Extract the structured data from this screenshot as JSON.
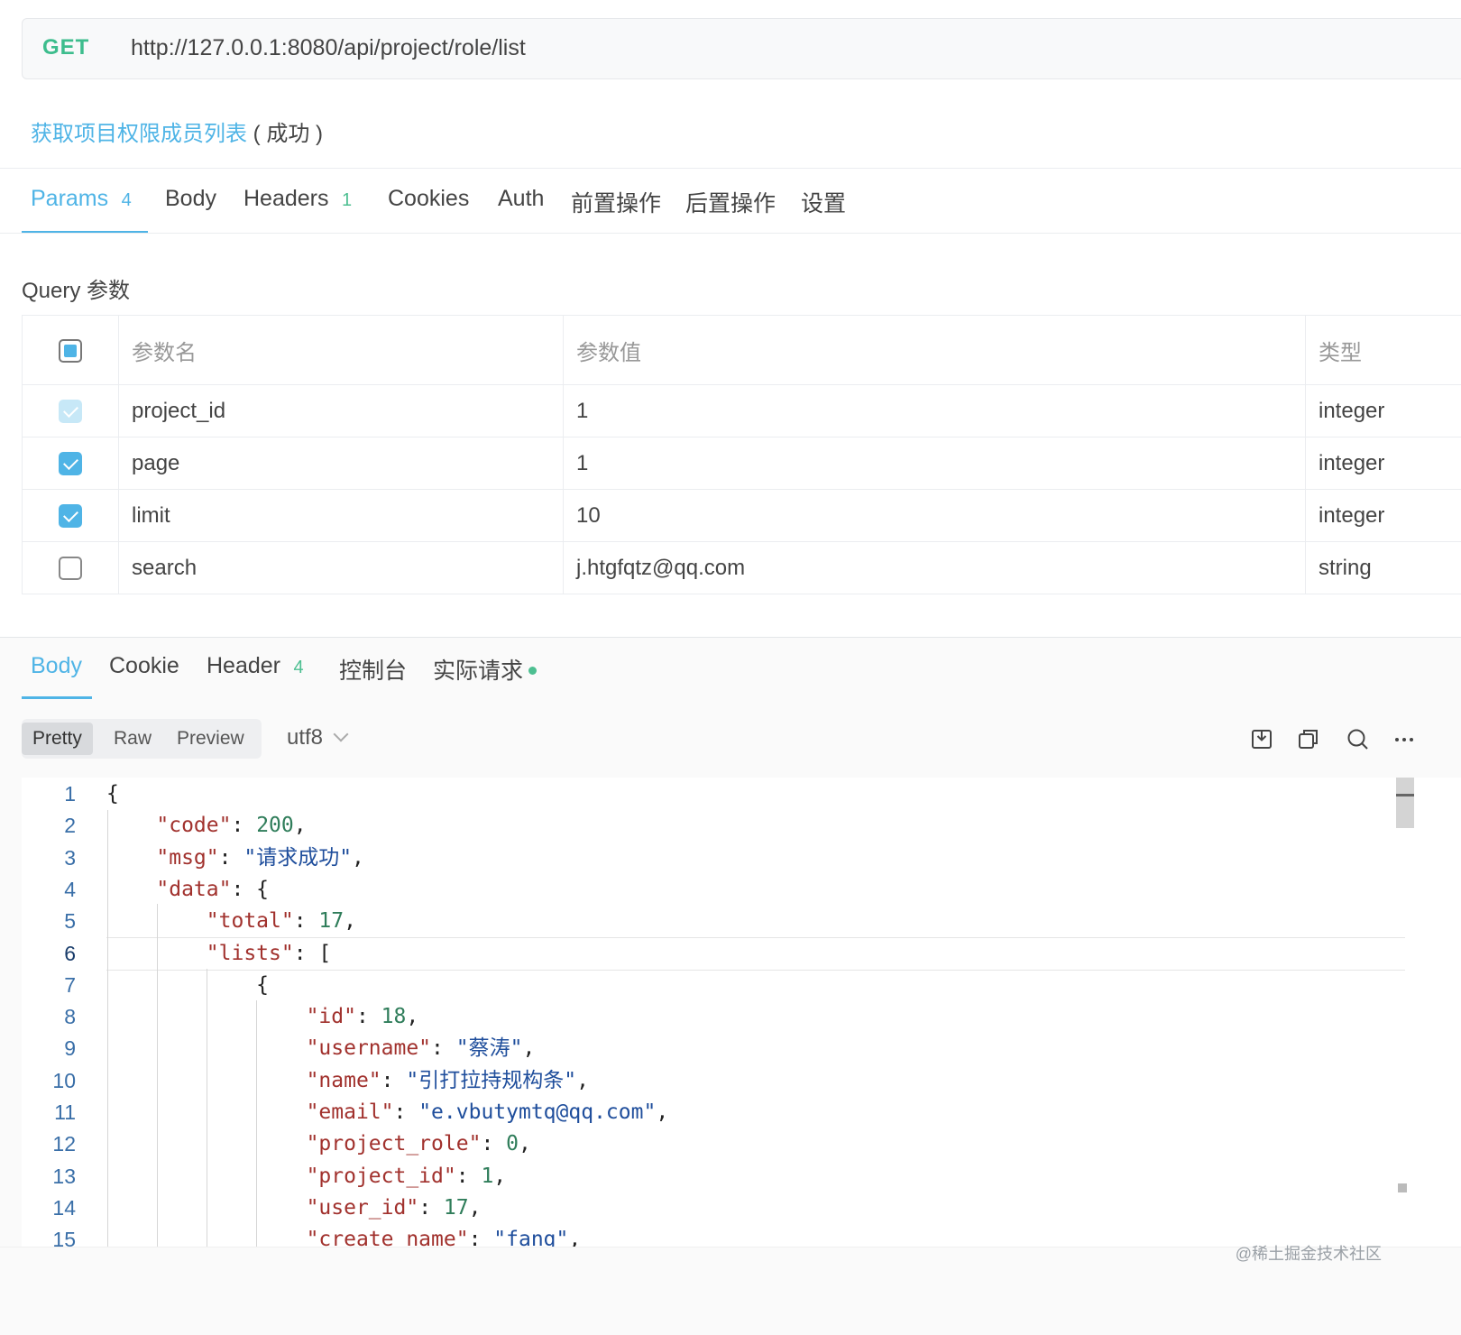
{
  "request": {
    "method": "GET",
    "url": "http://127.0.0.1:8080/api/project/role/list",
    "api_name": "获取项目权限成员列表",
    "api_status": "( 成功 )"
  },
  "request_tabs": [
    {
      "label": "Params",
      "count": "4"
    },
    {
      "label": "Body"
    },
    {
      "label": "Headers",
      "count": "1"
    },
    {
      "label": "Cookies"
    },
    {
      "label": "Auth"
    },
    {
      "label": "前置操作"
    },
    {
      "label": "后置操作"
    },
    {
      "label": "设置"
    }
  ],
  "query_section_label": "Query 参数",
  "params_table": {
    "headers": [
      "参数名",
      "参数值",
      "类型"
    ],
    "rows": [
      {
        "checked": "light",
        "name": "project_id",
        "value": "1",
        "type": "integer"
      },
      {
        "checked": "yes",
        "name": "page",
        "value": "1",
        "type": "integer"
      },
      {
        "checked": "yes",
        "name": "limit",
        "value": "10",
        "type": "integer"
      },
      {
        "checked": "no",
        "name": "search",
        "value": "j.htgfqtz@qq.com",
        "type": "string"
      }
    ]
  },
  "response_tabs": [
    {
      "label": "Body"
    },
    {
      "label": "Cookie"
    },
    {
      "label": "Header",
      "count": "4"
    },
    {
      "label": "控制台"
    },
    {
      "label": "实际请求"
    }
  ],
  "view_modes": [
    "Pretty",
    "Raw",
    "Preview"
  ],
  "encoding": "utf8",
  "toolbar_icons": [
    "save-icon",
    "copy-icon",
    "search-icon",
    "more-icon"
  ],
  "code_lines": [
    {
      "n": "1",
      "text": "{"
    },
    {
      "n": "2",
      "text": "    \"code\": 200,"
    },
    {
      "n": "3",
      "text": "    \"msg\": \"请求成功\","
    },
    {
      "n": "4",
      "text": "    \"data\": {"
    },
    {
      "n": "5",
      "text": "        \"total\": 17,"
    },
    {
      "n": "6",
      "text": "        \"lists\": ["
    },
    {
      "n": "7",
      "text": "            {"
    },
    {
      "n": "8",
      "text": "                \"id\": 18,"
    },
    {
      "n": "9",
      "text": "                \"username\": \"蔡涛\","
    },
    {
      "n": "10",
      "text": "                \"name\": \"引打拉持规构条\","
    },
    {
      "n": "11",
      "text": "                \"email\": \"e.vbutymtq@qq.com\","
    },
    {
      "n": "12",
      "text": "                \"project_role\": 0,"
    },
    {
      "n": "13",
      "text": "                \"project_id\": 1,"
    },
    {
      "n": "14",
      "text": "                \"user_id\": 17,"
    },
    {
      "n": "15",
      "text": "                \"create_name\": \"fang\","
    }
  ],
  "watermark": "@稀土掘金技术社区",
  "colors": {
    "accent": "#4fb4e6",
    "method_get": "#3dbd8d",
    "count_badge": "#4dbf91"
  }
}
